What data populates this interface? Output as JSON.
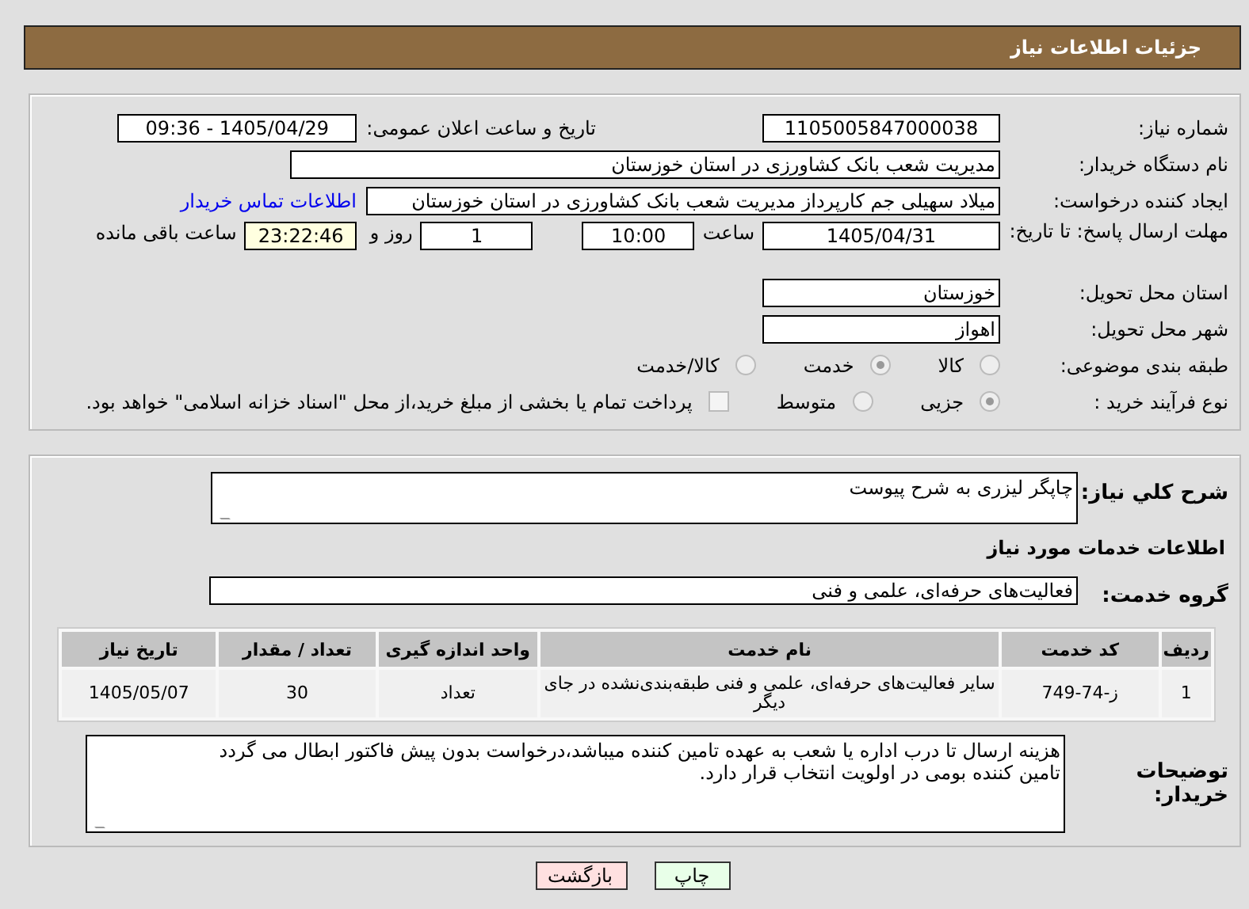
{
  "header": {
    "title": "جزئیات اطلاعات نیاز"
  },
  "need_number": {
    "label": "شماره نیاز:",
    "value": "1105005847000038"
  },
  "announce": {
    "label": "تاریخ و ساعت اعلان عمومی:",
    "value": "1405/04/29 - 09:36"
  },
  "buyer_org": {
    "label": "نام دستگاه خریدار:",
    "value": "مدیریت شعب بانک کشاورزی در استان خوزستان"
  },
  "requester": {
    "label": "ایجاد کننده درخواست:",
    "value": "میلاد سهیلی جم کارپرداز مدیریت شعب بانک کشاورزی در استان خوزستان",
    "link": "اطلاعات تماس خریدار"
  },
  "deadline": {
    "label": "مهلت ارسال پاسخ: تا تاریخ:",
    "date": "1405/04/31",
    "time_label": "ساعت",
    "time": "10:00",
    "days": "1",
    "days_label": "روز و",
    "remaining": "23:22:46",
    "remaining_label": "ساعت باقی مانده"
  },
  "province": {
    "label": "استان محل تحویل:",
    "value": "خوزستان"
  },
  "city": {
    "label": "شهر محل تحویل:",
    "value": "اهواز"
  },
  "category": {
    "label": "طبقه بندی موضوعی:",
    "options": [
      {
        "label": "کالا",
        "selected": false
      },
      {
        "label": "خدمت",
        "selected": true
      },
      {
        "label": "کالا/خدمت",
        "selected": false
      }
    ]
  },
  "process": {
    "label": "نوع فرآیند خرید :",
    "options": [
      {
        "label": "جزیی",
        "selected": true
      },
      {
        "label": "متوسط",
        "selected": false
      }
    ],
    "payment": {
      "label": "پرداخت تمام یا بخشی از مبلغ خرید،از محل \"اسناد خزانه اسلامی\" خواهد بود.",
      "checked": false
    }
  },
  "description": {
    "label": "شرح کلي نياز:",
    "value": "چاپگر لیزری به شرح پیوست"
  },
  "services_title": "اطلاعات خدمات مورد نیاز",
  "service_group": {
    "label": "گروه خدمت:",
    "value": "فعالیت‌های حرفه‌ای، علمی و فنی"
  },
  "table": {
    "columns": [
      "ردیف",
      "کد خدمت",
      "نام خدمت",
      "واحد اندازه گیری",
      "تعداد / مقدار",
      "تاریخ نیاز"
    ],
    "rows": [
      [
        "1",
        "ز-74-749",
        "سایر فعالیت‌های حرفه‌ای، علمی و فنی طبقه‌بندی‌نشده در جای دیگر",
        "تعداد",
        "30",
        "1405/05/07"
      ]
    ]
  },
  "notes": {
    "label": "توضیحات خریدار:",
    "value": "هزینه ارسال تا درب اداره یا شعب به عهده تامین کننده میباشد،درخواست بدون پیش فاکتور ابطال می گردد\nتامین کننده بومی در اولویت انتخاب قرار دارد."
  },
  "buttons": [
    {
      "label": "چاپ",
      "kind": "print"
    },
    {
      "label": "بازگشت",
      "kind": "back"
    }
  ]
}
